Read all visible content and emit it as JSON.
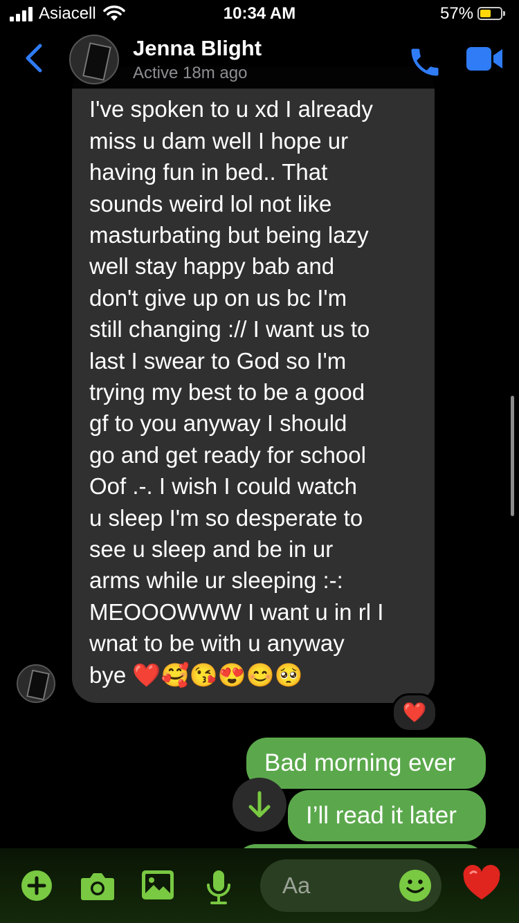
{
  "status_bar": {
    "carrier": "Asiacell",
    "time": "10:34 AM",
    "battery": "57%",
    "battery_color": "#ffd60a"
  },
  "header": {
    "contact_name": "Jenna Blight",
    "activity_status": "Active 18m ago",
    "accent_color": "#2f7cf6"
  },
  "conversation": {
    "incoming_message": "I've spoken to u xd I already\nmiss u dam well I hope ur\nhaving fun in bed.. That\nsounds weird lol not like\nmasturbating but being lazy\nwell stay happy bab and\ndon't give up on us bc I'm\nstill changing :// I want us to\nlast I swear to God so I'm\ntrying my best to be a good\ngf to you anyway I should\ngo and get ready for school\nOof .-. I wish I could watch\nu sleep I'm so desperate to\nsee u sleep and be in ur\narms while ur sleeping :-:\nMEOOOWWW I want u in rl I\nwnat to be with u anyway\nbye ❤️🥰😘😍😊🥺",
    "reaction": "❤️",
    "outgoing_messages": [
      "Bad morning ever",
      "I’ll read it later"
    ],
    "outgoing_color": "#5ba84c"
  },
  "composer": {
    "placeholder": "Aa",
    "icons": [
      "plus-icon",
      "camera-icon",
      "image-icon",
      "mic-icon",
      "smile-icon",
      "heart-icon"
    ],
    "accent_color": "#79c942"
  }
}
